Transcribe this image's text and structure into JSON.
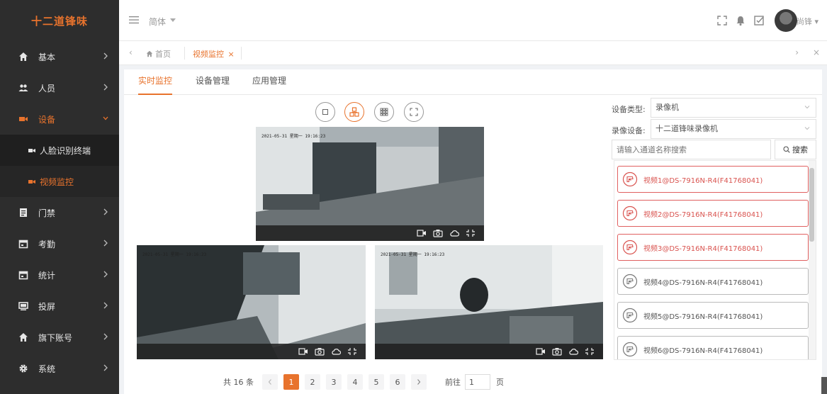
{
  "app": {
    "logo": "十二道锋味"
  },
  "sidebar": {
    "items": [
      {
        "label": "基本",
        "icon": "home-icon"
      },
      {
        "label": "人员",
        "icon": "users-icon"
      },
      {
        "label": "设备",
        "icon": "camera-icon",
        "active": true,
        "children": [
          {
            "label": "人脸识别终端",
            "icon": "camera-icon"
          },
          {
            "label": "视频监控",
            "icon": "camera-icon",
            "active": true
          }
        ]
      },
      {
        "label": "门禁",
        "icon": "document-icon"
      },
      {
        "label": "考勤",
        "icon": "calendar-icon"
      },
      {
        "label": "统计",
        "icon": "calendar-icon"
      },
      {
        "label": "投屏",
        "icon": "monitor-icon"
      },
      {
        "label": "旗下账号",
        "icon": "home-icon"
      },
      {
        "label": "系统",
        "icon": "gear-icon"
      }
    ]
  },
  "header": {
    "language": "简体",
    "username": "尚锋"
  },
  "tabs": {
    "home": "首页",
    "current": "视频监控",
    "close": "×"
  },
  "subtabs": [
    {
      "label": "实时监控",
      "active": true
    },
    {
      "label": "设备管理"
    },
    {
      "label": "应用管理"
    }
  ],
  "videos": [
    {
      "timestamp": "2021-05-31 星期一 19:16:23"
    },
    {
      "timestamp": "2021-05-31 星期一 19:16:23"
    },
    {
      "timestamp": "2021-05-31 星期一 19:16:23"
    }
  ],
  "panel": {
    "device_type_label": "设备类型:",
    "device_type_value": "录像机",
    "recorder_label": "录像设备:",
    "recorder_value": "十二道锋味录像机",
    "search_placeholder": "请输入通道名称搜索",
    "search_button": "搜索",
    "channels": [
      {
        "label": "视频1@DS-7916N-R4(F41768041)",
        "active": true
      },
      {
        "label": "视频2@DS-7916N-R4(F41768041)",
        "active": true
      },
      {
        "label": "视频3@DS-7916N-R4(F41768041)",
        "active": true
      },
      {
        "label": "视频4@DS-7916N-R4(F41768041)",
        "active": false
      },
      {
        "label": "视频5@DS-7916N-R4(F41768041)",
        "active": false
      },
      {
        "label": "视频6@DS-7916N-R4(F41768041)",
        "active": false
      }
    ]
  },
  "pagination": {
    "total": "共 16 条",
    "pages": [
      "1",
      "2",
      "3",
      "4",
      "5",
      "6"
    ],
    "current": "1",
    "goto_label": "前往",
    "goto_value": "1",
    "page_suffix": "页"
  },
  "colors": {
    "accent": "#e8732d",
    "sidebar": "#2d2d2d",
    "danger": "#d9534f"
  }
}
